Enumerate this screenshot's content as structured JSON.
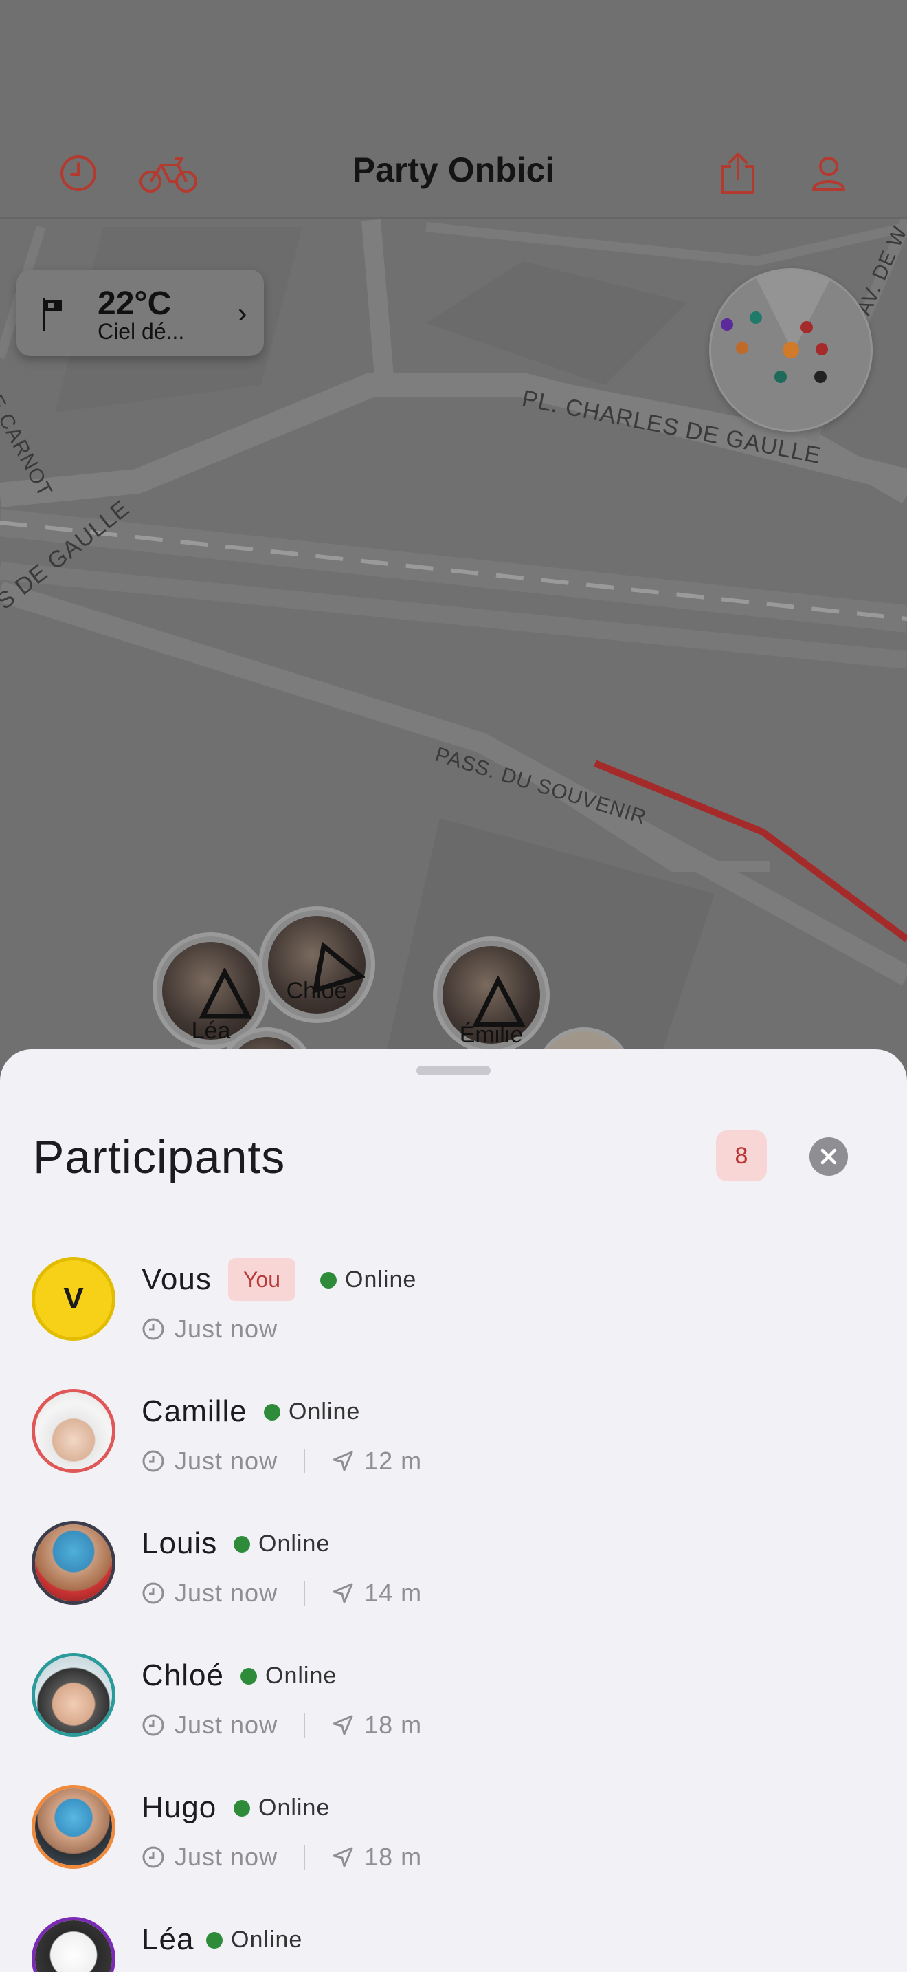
{
  "header": {
    "title": "Party Onbici",
    "history_icon": "clock-icon",
    "bike_icon": "bicycle-icon",
    "share_icon": "share-icon",
    "profile_icon": "person-icon"
  },
  "weather": {
    "temperature": "22°C",
    "description": "Ciel dé..."
  },
  "map": {
    "streets": [
      "PL. CHARLES DE GAULLE",
      "PASS. DU SOUVENIR",
      "S DE GAULLE",
      "UE CARNOT",
      "AV. DE W"
    ],
    "markers": [
      "Léa",
      "Chloé",
      "Émilie"
    ]
  },
  "sheet": {
    "title": "Participants",
    "count": "8"
  },
  "participants": [
    {
      "name": "Vous",
      "initial": "V",
      "you_label": "You",
      "status": "Online",
      "time": "Just now",
      "distance": ""
    },
    {
      "name": "Camille",
      "status": "Online",
      "time": "Just now",
      "distance": "12 m",
      "ring": "#e05757"
    },
    {
      "name": "Louis",
      "status": "Online",
      "time": "Just now",
      "distance": "14 m",
      "ring": "#3c3c4a"
    },
    {
      "name": "Chloé",
      "status": "Online",
      "time": "Just now",
      "distance": "18 m",
      "ring": "#2a9a9a"
    },
    {
      "name": "Hugo",
      "status": "Online",
      "time": "Just now",
      "distance": "18 m",
      "ring": "#f08a3c"
    },
    {
      "name": "Léa",
      "status": "Online",
      "time": "",
      "distance": "",
      "ring": "#7a2ab5"
    }
  ],
  "colors": {
    "accent": "#c0392b",
    "online": "#2e8b3a",
    "route": "#a52a2a"
  }
}
